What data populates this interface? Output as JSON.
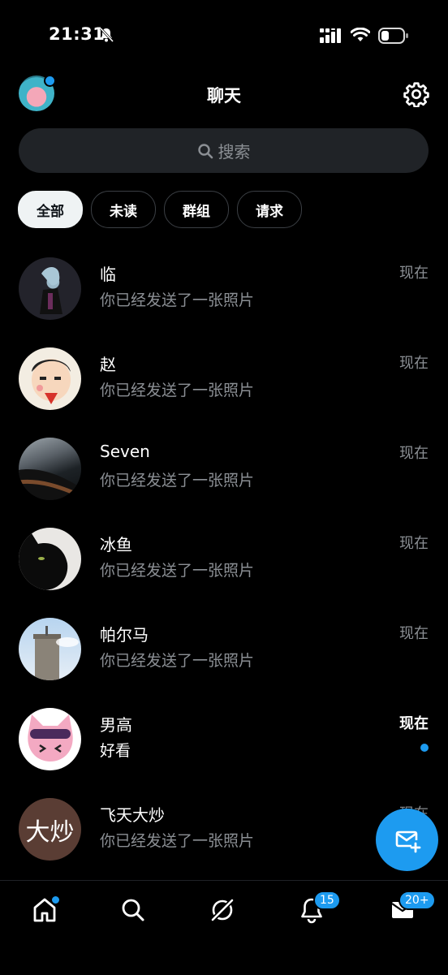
{
  "status_bar": {
    "time": "21:31"
  },
  "header": {
    "title": "聊天"
  },
  "search": {
    "placeholder": "搜索"
  },
  "filters": [
    {
      "label": "全部",
      "active": true
    },
    {
      "label": "未读",
      "active": false
    },
    {
      "label": "群组",
      "active": false
    },
    {
      "label": "请求",
      "active": false
    }
  ],
  "conversations": [
    {
      "name": "临",
      "time": "现在",
      "preview": "你已经发送了一张照片",
      "unread": false
    },
    {
      "name": "赵",
      "time": "现在",
      "preview": "你已经发送了一张照片",
      "unread": false
    },
    {
      "name": "Seven",
      "time": "现在",
      "preview": "你已经发送了一张照片",
      "unread": false
    },
    {
      "name": "冰鱼",
      "time": "现在",
      "preview": "你已经发送了一张照片",
      "unread": false
    },
    {
      "name": "帕尔马",
      "time": "现在",
      "preview": "你已经发送了一张照片",
      "unread": false
    },
    {
      "name": "男高",
      "time": "现在",
      "preview": "好看",
      "unread": true
    },
    {
      "name": "飞天大炒",
      "time": "现在",
      "preview": "你已经发送了一张照片",
      "unread": false,
      "avatar_text": "大炒"
    }
  ],
  "bottom_nav": {
    "notifications_badge": "15",
    "messages_badge": "20+"
  },
  "colors": {
    "accent": "#1d9bf0",
    "background": "#000000",
    "muted": "#8b8f94"
  }
}
